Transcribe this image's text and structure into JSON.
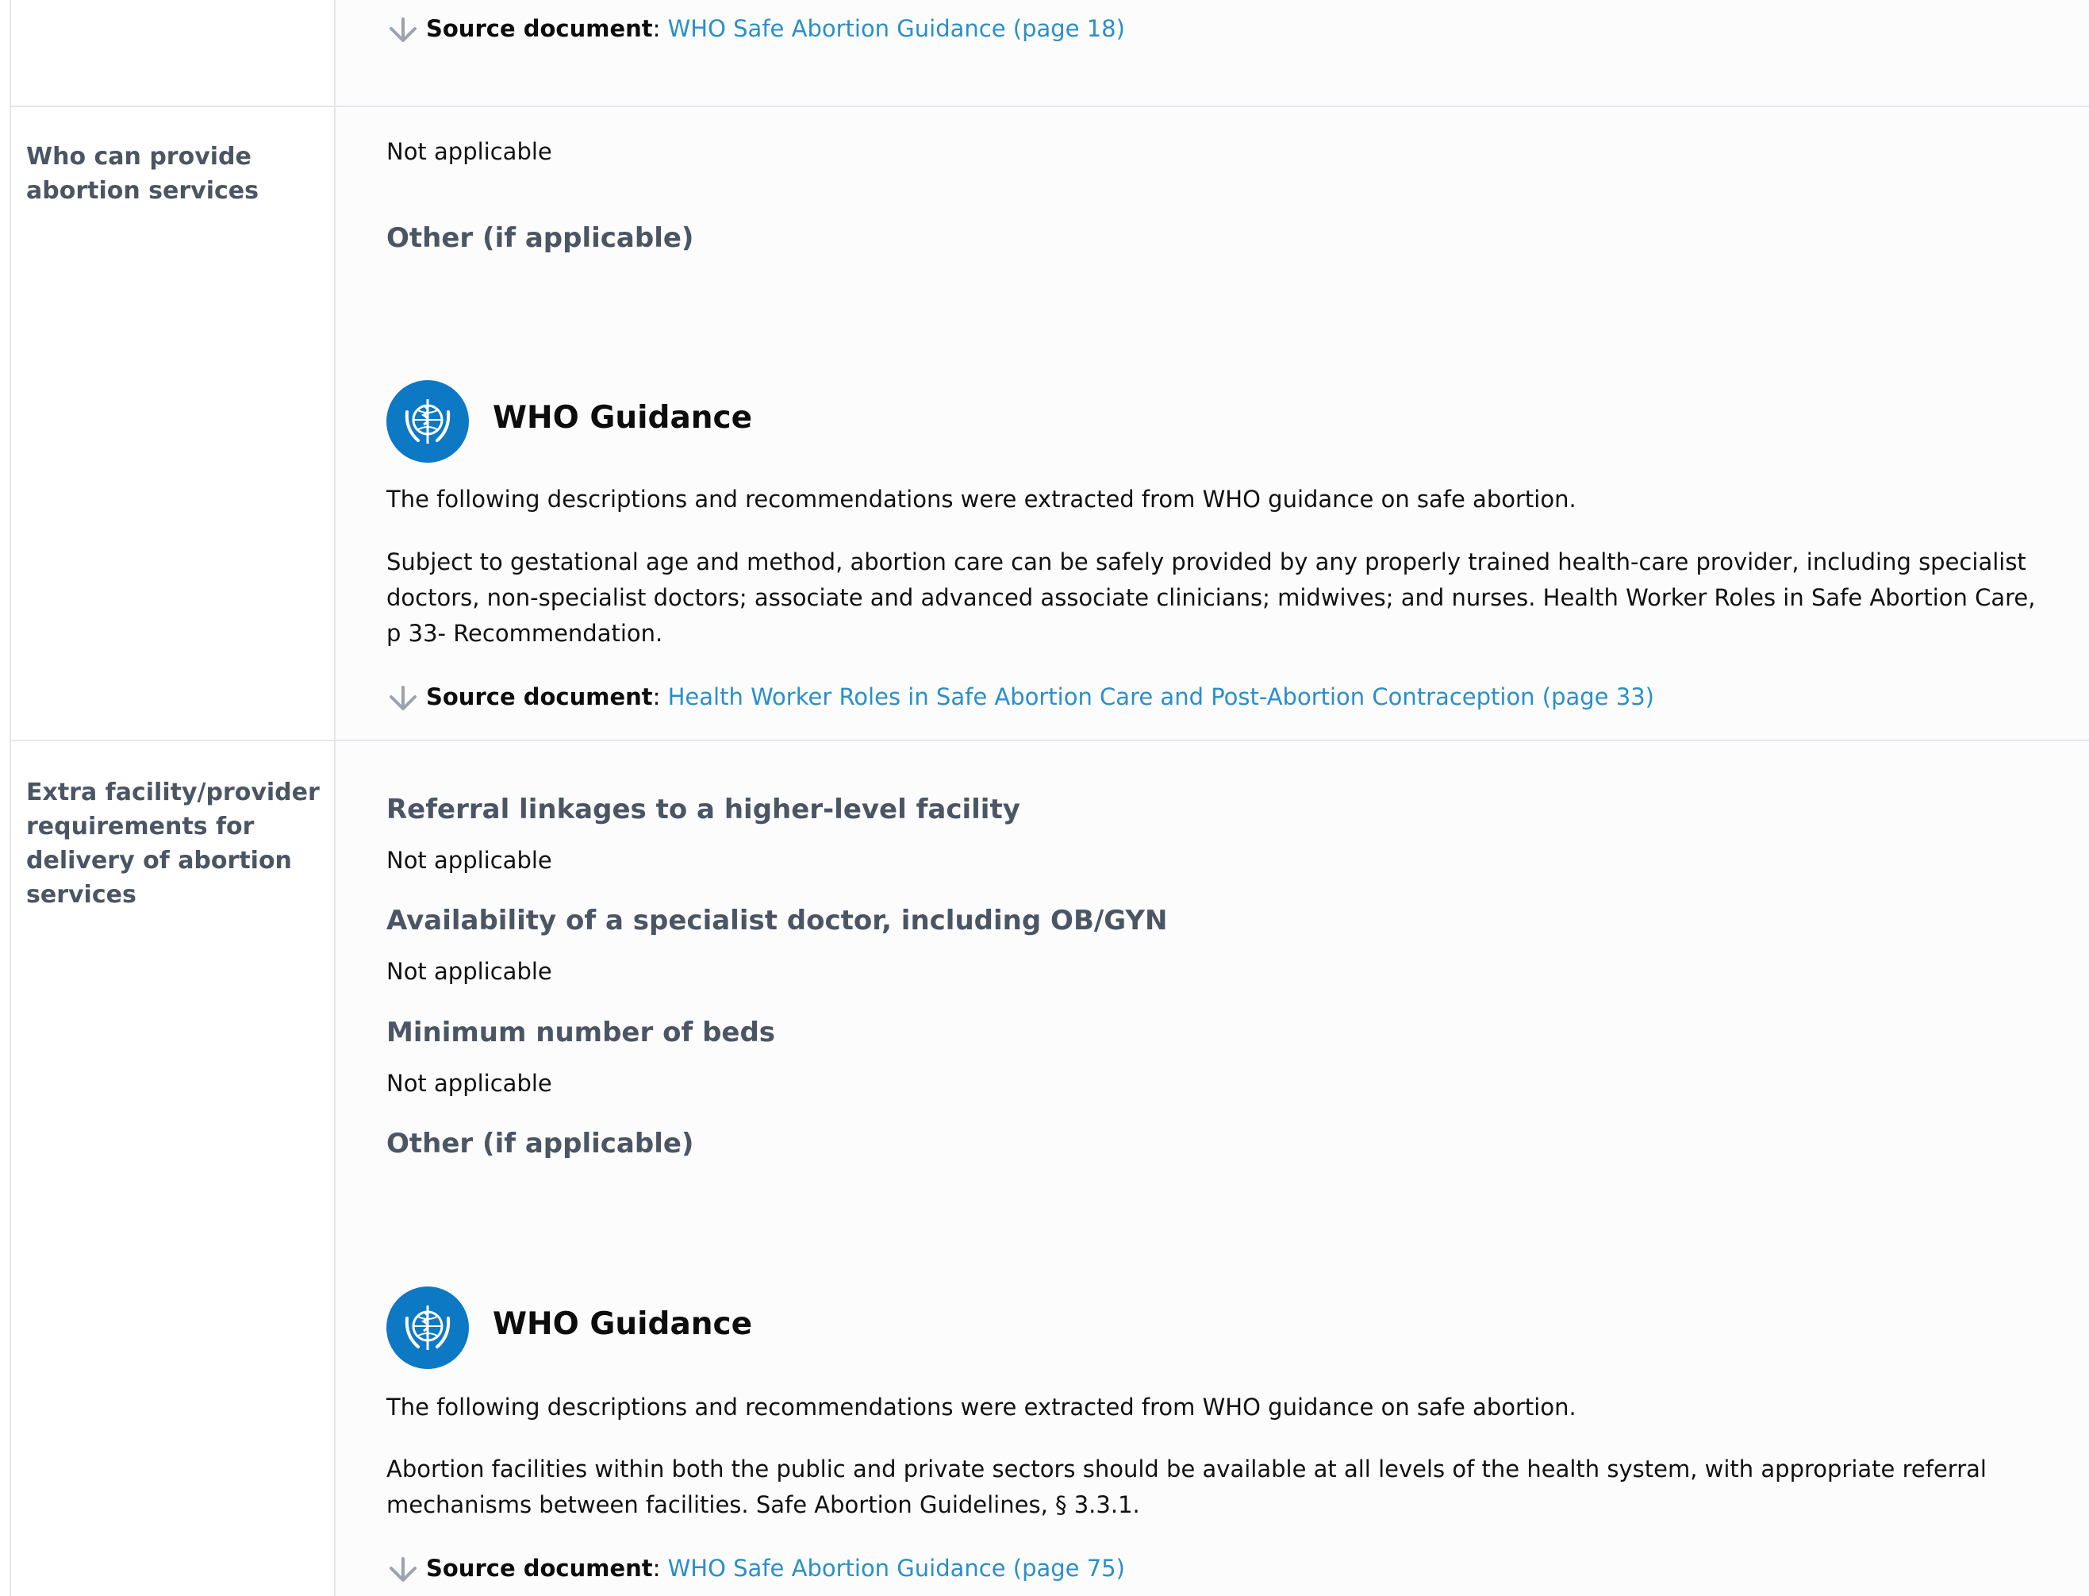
{
  "top": {
    "source_label": "Source document",
    "source_link": "WHO Safe Abortion Guidance (page 18)"
  },
  "row1": {
    "label": "Who can provide abortion services",
    "value": "Not applicable",
    "other_heading": "Other (if applicable)",
    "guidance": {
      "title": "WHO Guidance",
      "intro": "The following descriptions and recommendations were extracted from WHO guidance on safe abortion.",
      "text": "Subject to gestational age and method, abortion care can be safely provided by any properly trained health-care provider, including specialist doctors, non-specialist doctors; associate and advanced associate clinicians; midwives; and nurses. Health Worker Roles in Safe Abortion Care, p 33- Recommendation.",
      "source_label": "Source document",
      "source_link": "Health Worker Roles in Safe Abortion Care and Post-Abortion Contraception (page 33)"
    }
  },
  "row2": {
    "label": "Extra facility/provider requirements for delivery of abortion services",
    "items": [
      {
        "heading": "Referral linkages to a higher-level facility",
        "value": "Not applicable"
      },
      {
        "heading": "Availability of a specialist doctor, including OB/GYN",
        "value": "Not applicable"
      },
      {
        "heading": "Minimum number of beds",
        "value": "Not applicable"
      }
    ],
    "other_heading": "Other (if applicable)",
    "guidance": {
      "title": "WHO Guidance",
      "intro": "The following descriptions and recommendations were extracted from WHO guidance on safe abortion.",
      "text": "Abortion facilities within both the public and private sectors should be available at all levels of the health system, with appropriate referral mechanisms between facilities. Safe Abortion Guidelines, § 3.3.1.",
      "source_label": "Source document",
      "source_link": "WHO Safe Abortion Guidance (page 75)"
    }
  },
  "colors": {
    "link": "#2a8fc9",
    "who_blue": "#0d79c4",
    "label_gray": "#4b5563",
    "divider": "#e5e7eb"
  },
  "icons": {
    "source": "arrow-down-icon",
    "logo": "who-emblem-icon"
  }
}
